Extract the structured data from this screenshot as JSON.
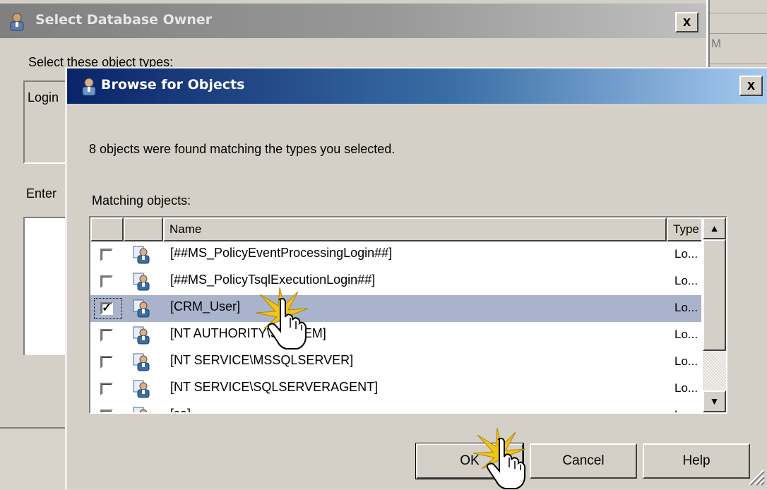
{
  "background_window": {
    "title": "Select Database Owner",
    "close_label": "x",
    "label_object_types": "Select these object types:",
    "object_types_value": "Login",
    "label_enter": "Enter",
    "side_text": "M"
  },
  "dialog": {
    "title": "Browse for Objects",
    "close_label": "x",
    "found_text": "8 objects were found matching the types you selected.",
    "matching_label": "Matching objects:",
    "columns": {
      "check": "",
      "icon": "",
      "name": "Name",
      "type": "Type"
    },
    "rows": [
      {
        "checked": false,
        "name": "[##MS_PolicyEventProcessingLogin##]",
        "type": "Lo..."
      },
      {
        "checked": false,
        "name": "[##MS_PolicyTsqlExecutionLogin##]",
        "type": "Lo..."
      },
      {
        "checked": true,
        "selected": true,
        "name": "[CRM_User]",
        "type": "Lo..."
      },
      {
        "checked": false,
        "name": "[NT AUTHORITY\\SYSTEM]",
        "type": "Lo..."
      },
      {
        "checked": false,
        "name": "[NT SERVICE\\MSSQLSERVER]",
        "type": "Lo..."
      },
      {
        "checked": false,
        "name": "[NT SERVICE\\SQLSERVERAGENT]",
        "type": "Lo..."
      },
      {
        "checked": false,
        "name": "[sa]",
        "type": "Lo..."
      }
    ],
    "buttons": {
      "ok": "OK",
      "cancel": "Cancel",
      "help": "Help"
    }
  },
  "icons": {
    "title_icon": "user-icon",
    "row_icon": "user-login-icon",
    "cursor": "hand-pointer-icon",
    "click_marker": "click-burst-icon"
  },
  "colors": {
    "active_title_start": "#0a246a",
    "active_title_end": "#a6caf0",
    "inactive_title": "#808080",
    "selected_row": "#a9b3cc",
    "dialog_face": "#d4d0c8",
    "click_burst": "#f2c318"
  }
}
